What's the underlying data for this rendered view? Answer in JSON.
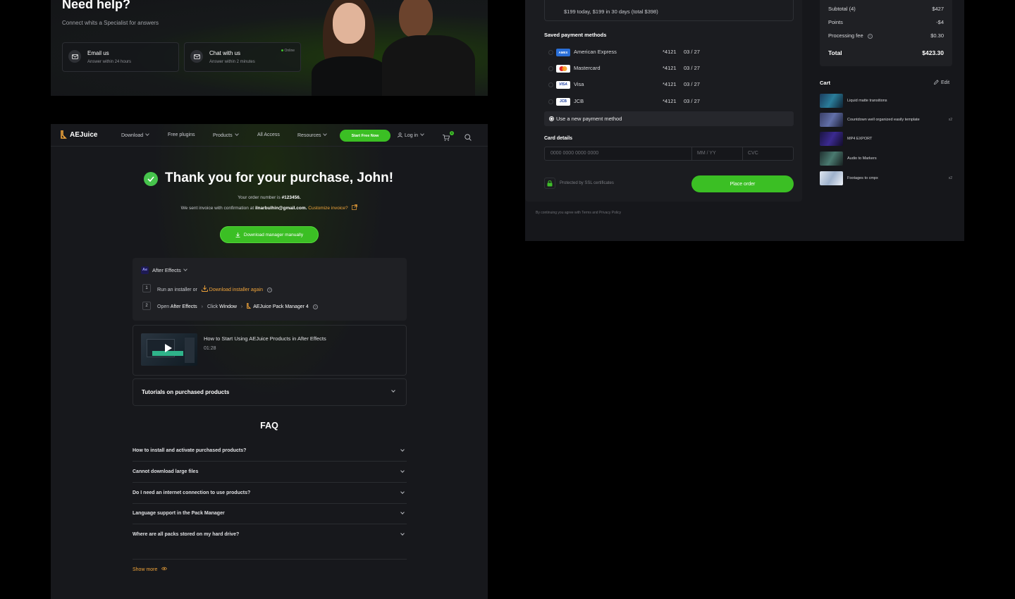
{
  "help": {
    "title": "Need help?",
    "subtitle": "Connect whits a Specialist for answers",
    "email": {
      "title": "Email us",
      "sub": "Answer within 24 hours"
    },
    "chat": {
      "title": "Chat with us",
      "sub": "Answer within 2 minutes",
      "status": "Online"
    }
  },
  "nav": {
    "logo": "AEJuice",
    "items": [
      "Download",
      "Free plugins",
      "Products",
      "All Access",
      "Resources"
    ],
    "cta": "Start Free Now",
    "login": "Log in",
    "cart_count": "0"
  },
  "thanks": {
    "title": "Thank you for your purchase, John!",
    "order_prefix": "Your order number is ",
    "order_number": "#123456.",
    "invoice_prefix": "We sent invoice with confirmation at ",
    "email": "ilnarbulhin@gmail.com.",
    "customize": "Customize invoice?",
    "download_btn": "Download manager manually"
  },
  "install": {
    "app": "After Effects",
    "app_badge": "Ae",
    "step1_num": "1",
    "step1_text": "Run an installer or",
    "step1_link": "Download installer again",
    "step2_num": "2",
    "step2_a": "Open",
    "step2_b": "After Effects",
    "step2_c": "Click",
    "step2_d": "Window",
    "step2_e": "AEJuice Pack Manager 4"
  },
  "video": {
    "title": "How to Start Using AEJuice Products in After Effects",
    "duration": "01:28"
  },
  "tutorials": {
    "title": "Tutorials on purchased products"
  },
  "faq": {
    "title": "FAQ",
    "items": [
      "How to install and activate purchased products?",
      "Cannot download large files",
      "Do I need an internet connection to use products?",
      "Language support in the Pack Manager",
      "Where are all packs stored on my hard drive?"
    ],
    "show_more": "Show more"
  },
  "checkout": {
    "split_text": "$199 today, $199 in 30 days (total $398)",
    "saved_title": "Saved payment methods",
    "methods": [
      {
        "name": "American Express",
        "last4": "*4121",
        "exp": "03 / 27",
        "brand": "AMEX"
      },
      {
        "name": "Mastercard",
        "last4": "*4121",
        "exp": "03 / 27",
        "brand": ""
      },
      {
        "name": "Visa",
        "last4": "*4121",
        "exp": "03 / 27",
        "brand": "VISA"
      },
      {
        "name": "JCB",
        "last4": "*4121",
        "exp": "03 / 27",
        "brand": "JCB"
      }
    ],
    "new_method": "Use a new payment method",
    "card_title": "Card details",
    "card_placeholder": "0000 0000 0000 0000",
    "exp_placeholder": "MM / YY",
    "cvc_placeholder": "CVC",
    "ssl": "Protected by SSL certificates",
    "place_order": "Place order",
    "terms": "By continuing you agree with Terms and Privacy Policy"
  },
  "summary": {
    "subtotal_label": "Subtotal (4)",
    "subtotal": "$427",
    "points_label": "Points",
    "points": "-$4",
    "fee_label": "Processing fee",
    "fee": "$0.30",
    "total_label": "Total",
    "total": "$423.30"
  },
  "cart": {
    "title": "Cart",
    "edit": "Edit",
    "items": [
      {
        "name": "Liquid matte transitions",
        "qty": ""
      },
      {
        "name": "Countdown well organized easily template",
        "qty": "x2"
      },
      {
        "name": "MP4 EXPORT",
        "qty": ""
      },
      {
        "name": "Audio to Markers",
        "qty": ""
      },
      {
        "name": "Footages to cmpx",
        "qty": "x2"
      }
    ]
  }
}
